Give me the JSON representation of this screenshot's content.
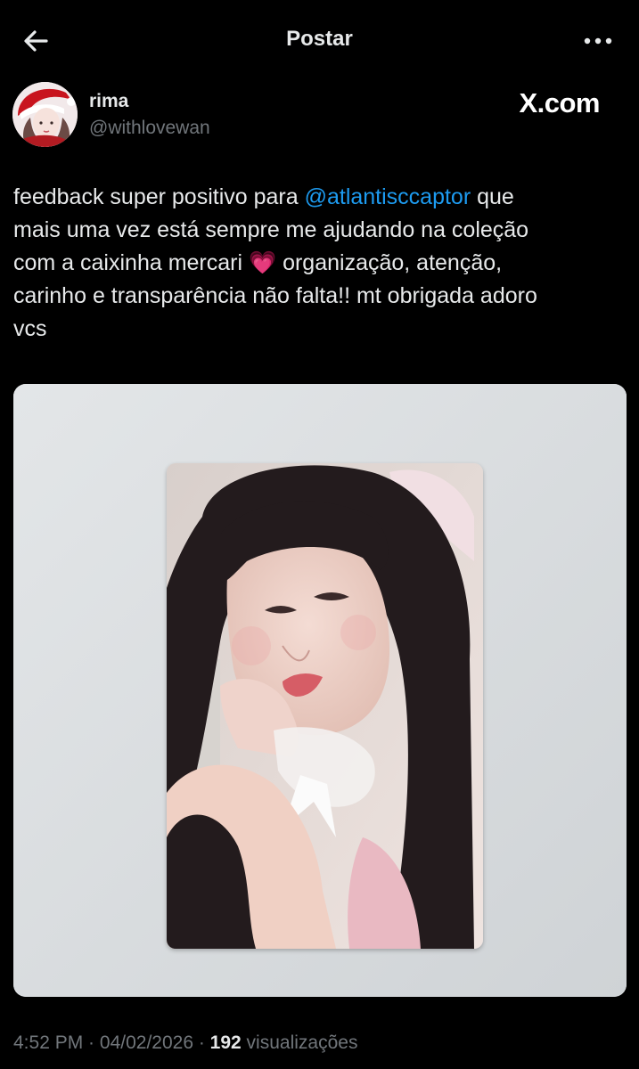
{
  "header": {
    "title": "Postar",
    "back_icon": "arrow-left-icon",
    "more_icon": "more-horizontal-icon"
  },
  "author": {
    "name": "rima",
    "handle": "@withlovewan",
    "watermark": "X.com"
  },
  "tweet": {
    "text_before_mention": "feedback super positivo para ",
    "mention": "@atlantisccaptor",
    "text_after_mention_1": " que\nmais uma vez está sempre me ajudando na coleção\ncom a caixinha mercari ",
    "emoji": "💗",
    "text_after_emoji": " organização, atenção,\ncarinho e transparência não falta!! mt obrigada adoro\nvcs"
  },
  "meta": {
    "time": "4:52 PM",
    "separator1": " · ",
    "date": "04/02/2026",
    "separator2": " · ",
    "views_count": "192",
    "views_label": " visualizações"
  },
  "colors": {
    "background": "#000000",
    "text": "#e7e9ea",
    "secondary": "#71767b",
    "link": "#1d9bf0"
  }
}
